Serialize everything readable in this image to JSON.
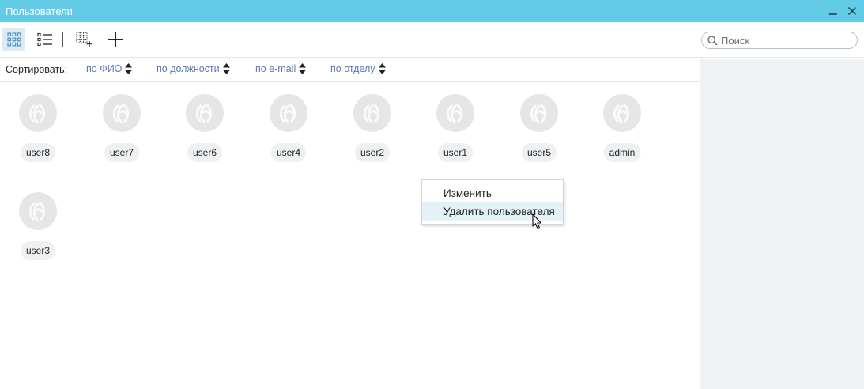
{
  "window": {
    "title": "Пользователи",
    "minimize_icon": "minimize-icon",
    "close_icon": "close-icon",
    "title_color": "#62cbe6"
  },
  "toolbar": {
    "grid_view_icon": "grid-view-icon",
    "list_view_icon": "list-view-icon",
    "add_group_icon": "add-group-icon",
    "add_user_icon": "plus-icon",
    "search": {
      "placeholder": "Поиск",
      "value": ""
    }
  },
  "sort": {
    "label": "Сортировать:",
    "options": [
      {
        "label": "по ФИО"
      },
      {
        "label": "по должности"
      },
      {
        "label": "по e-mail"
      },
      {
        "label": "по отделу"
      }
    ],
    "link_color": "#5b79b6"
  },
  "users": [
    {
      "name": "user8"
    },
    {
      "name": "user7"
    },
    {
      "name": "user6"
    },
    {
      "name": "user4"
    },
    {
      "name": "user2"
    },
    {
      "name": "user1"
    },
    {
      "name": "user5"
    },
    {
      "name": "admin"
    },
    {
      "name": "user3"
    }
  ],
  "context_menu": {
    "items": [
      {
        "label": "Изменить"
      },
      {
        "label": "Удалить пользователя"
      }
    ]
  }
}
